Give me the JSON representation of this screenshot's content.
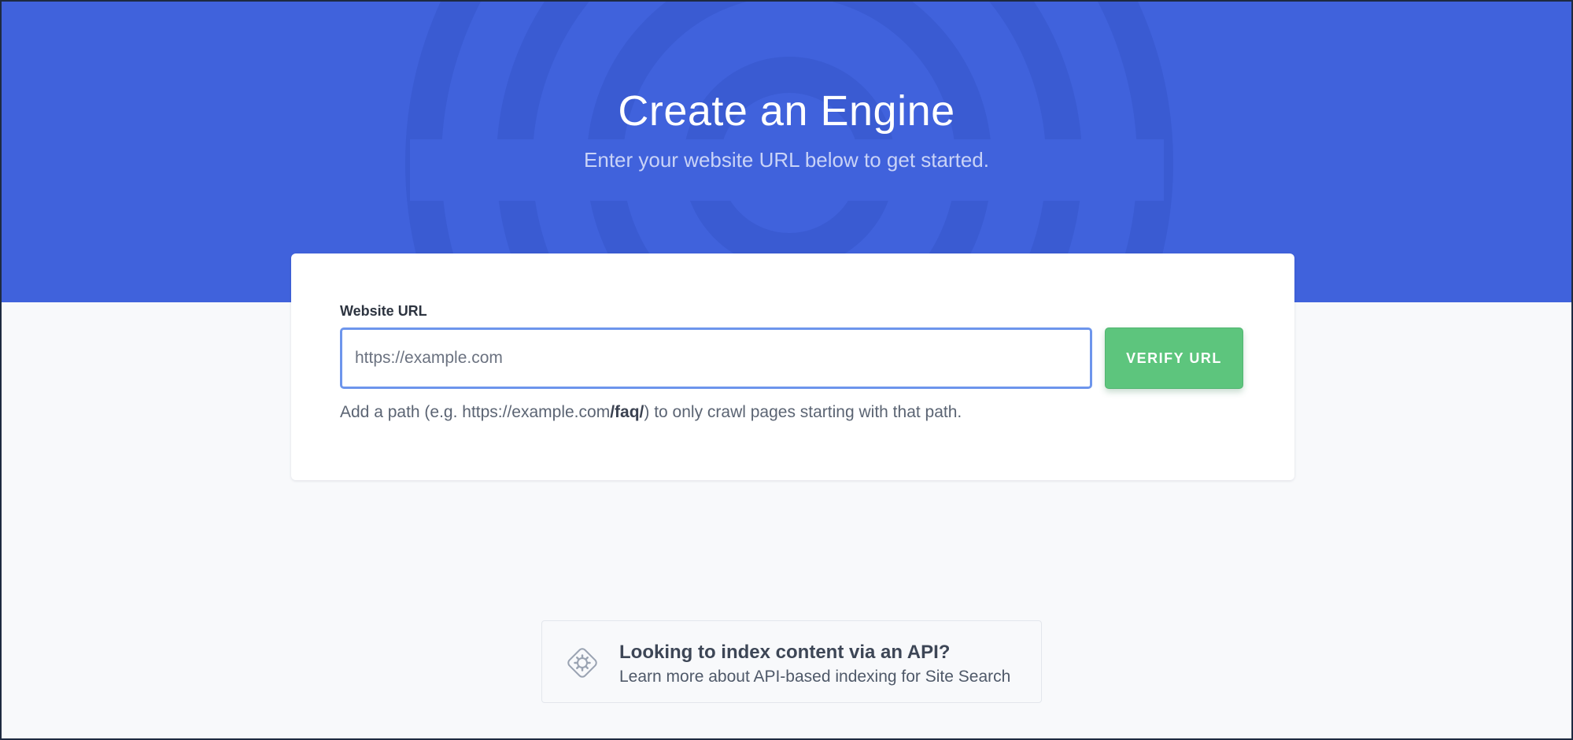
{
  "hero": {
    "title": "Create an Engine",
    "subtitle": "Enter your website URL below to get started."
  },
  "form": {
    "label": "Website URL",
    "url_placeholder": "https://example.com",
    "verify_label": "VERIFY URL",
    "hint_prefix": "Add a path (e.g. https://example.com",
    "hint_path": "/faq/",
    "hint_suffix": ") to only crawl pages starting with that path."
  },
  "api_box": {
    "icon": "gear-icon",
    "title": "Looking to index content via an API?",
    "link_text": "Learn more about API-based indexing for Site Search"
  },
  "colors": {
    "hero_bg": "#4062dc",
    "verify_button": "#5dc57d",
    "input_border": "#6d95ec",
    "page_bg": "#f8f9fb"
  }
}
